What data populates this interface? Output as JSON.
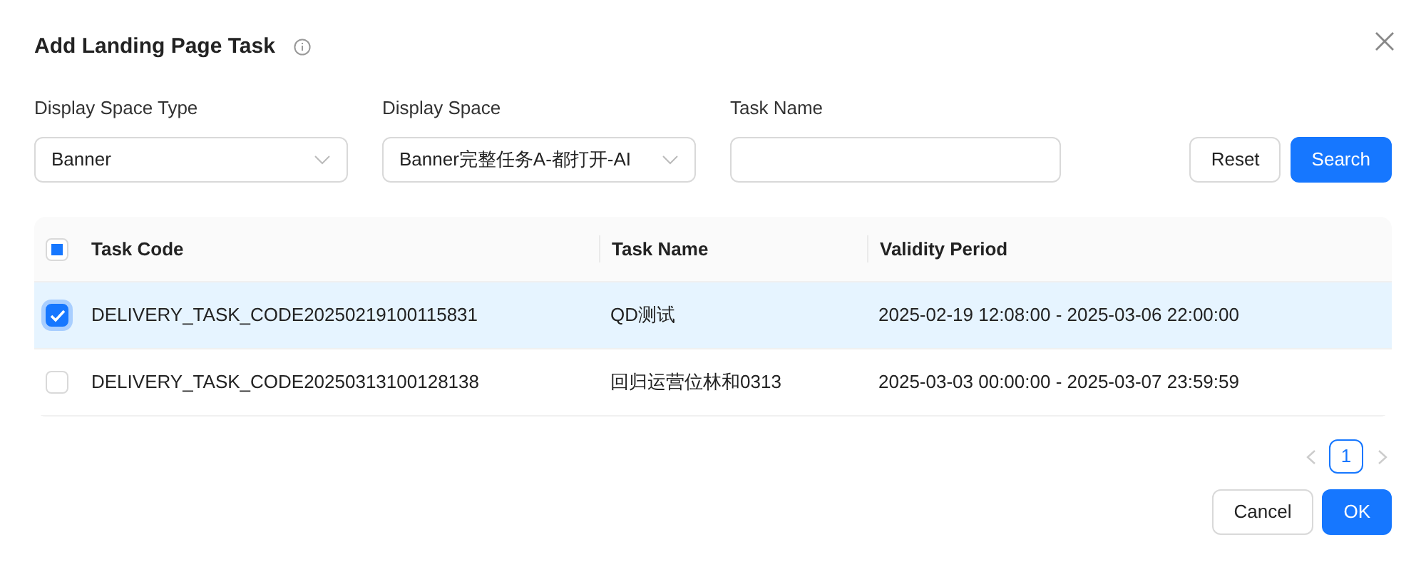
{
  "dialog": {
    "title": "Add Landing Page Task"
  },
  "filters": [
    {
      "kind": "select",
      "label": "Display Space Type",
      "value": "Banner"
    },
    {
      "kind": "select",
      "label": "Display Space",
      "value": "Banner完整任务A-都打开-AI"
    },
    {
      "kind": "text",
      "label": "Task Name"
    }
  ],
  "filter_buttons": [
    {
      "label": "Reset",
      "primary": false
    },
    {
      "label": "Search",
      "primary": true
    }
  ],
  "table": {
    "select_all_partial": true,
    "columns": [
      "Task Code",
      "Task Name",
      "Validity Period"
    ],
    "rows": [
      {
        "selected": true,
        "cells": [
          "DELIVERY_TASK_CODE20250219100115831",
          "QD测试",
          "2025-02-19 12:08:00 - 2025-03-06 22:00:00"
        ]
      },
      {
        "selected": false,
        "cells": [
          "DELIVERY_TASK_CODE20250313100128138",
          "回归运营位林和0313",
          "2025-03-03 00:00:00 - 2025-03-07 23:59:59"
        ]
      }
    ]
  },
  "pagination": {
    "pages": [
      {
        "label": "1",
        "selected": true
      }
    ],
    "prev_disabled": true,
    "next_disabled": true
  },
  "footer_buttons": [
    {
      "label": "Cancel",
      "primary": false
    },
    {
      "label": "OK",
      "primary": true
    }
  ]
}
